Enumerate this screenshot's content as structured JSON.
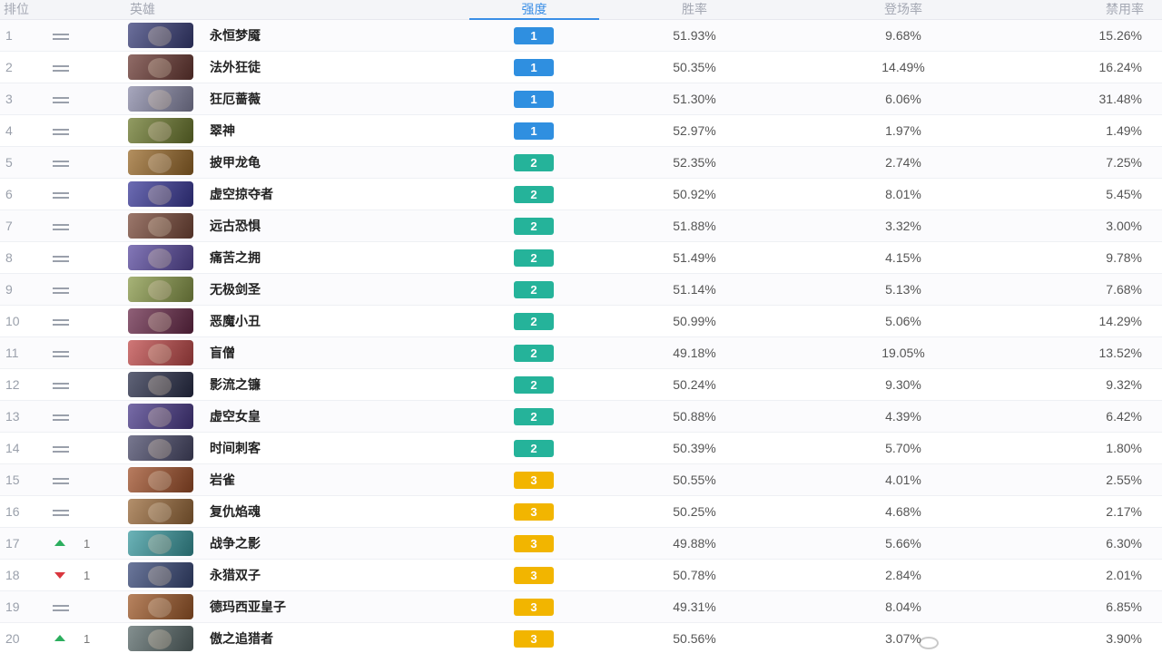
{
  "header": {
    "rank": "排位",
    "hero": "英雄",
    "tier": "强度",
    "win_rate": "胜率",
    "pick_rate": "登场率",
    "ban_rate": "禁用率"
  },
  "tier_colors": {
    "1": "#2f8fe0",
    "2": "#25b39a",
    "3": "#f2b500"
  },
  "trend_colors": {
    "up": "#2cae5e",
    "down": "#d9363e",
    "same": "#9aa0ab"
  },
  "rows": [
    {
      "rank": "1",
      "trend": "same",
      "change": "",
      "name": "永恒梦魇",
      "tier": "1",
      "win": "51.93%",
      "pick": "9.68%",
      "ban": "15.26%",
      "avatar_color": "#3a3f7a"
    },
    {
      "rank": "2",
      "trend": "same",
      "change": "",
      "name": "法外狂徒",
      "tier": "1",
      "win": "50.35%",
      "pick": "14.49%",
      "ban": "16.24%",
      "avatar_color": "#6b3a34"
    },
    {
      "rank": "3",
      "trend": "same",
      "change": "",
      "name": "狂厄蔷薇",
      "tier": "1",
      "win": "51.30%",
      "pick": "6.06%",
      "ban": "31.48%",
      "avatar_color": "#8a8aa8"
    },
    {
      "rank": "4",
      "trend": "same",
      "change": "",
      "name": "翠神",
      "tier": "1",
      "win": "52.97%",
      "pick": "1.97%",
      "ban": "1.49%",
      "avatar_color": "#6d7a2e"
    },
    {
      "rank": "5",
      "trend": "same",
      "change": "",
      "name": "披甲龙龟",
      "tier": "2",
      "win": "52.35%",
      "pick": "2.74%",
      "ban": "7.25%",
      "avatar_color": "#9a6a2a"
    },
    {
      "rank": "6",
      "trend": "same",
      "change": "",
      "name": "虚空掠夺者",
      "tier": "2",
      "win": "50.92%",
      "pick": "8.01%",
      "ban": "5.45%",
      "avatar_color": "#3b3a9a"
    },
    {
      "rank": "7",
      "trend": "same",
      "change": "",
      "name": "远古恐惧",
      "tier": "2",
      "win": "51.88%",
      "pick": "3.32%",
      "ban": "3.00%",
      "avatar_color": "#7a4a3a"
    },
    {
      "rank": "8",
      "trend": "same",
      "change": "",
      "name": "痛苦之拥",
      "tier": "2",
      "win": "51.49%",
      "pick": "4.15%",
      "ban": "9.78%",
      "avatar_color": "#5a4aa0"
    },
    {
      "rank": "9",
      "trend": "same",
      "change": "",
      "name": "无极剑圣",
      "tier": "2",
      "win": "51.14%",
      "pick": "5.13%",
      "ban": "7.68%",
      "avatar_color": "#8a9a4a"
    },
    {
      "rank": "10",
      "trend": "same",
      "change": "",
      "name": "恶魔小丑",
      "tier": "2",
      "win": "50.99%",
      "pick": "5.06%",
      "ban": "14.29%",
      "avatar_color": "#6a2a4a"
    },
    {
      "rank": "11",
      "trend": "same",
      "change": "",
      "name": "盲僧",
      "tier": "2",
      "win": "49.18%",
      "pick": "19.05%",
      "ban": "13.52%",
      "avatar_color": "#c04a4a"
    },
    {
      "rank": "12",
      "trend": "same",
      "change": "",
      "name": "影流之镰",
      "tier": "2",
      "win": "50.24%",
      "pick": "9.30%",
      "ban": "9.32%",
      "avatar_color": "#2a2f4a"
    },
    {
      "rank": "13",
      "trend": "same",
      "change": "",
      "name": "虚空女皇",
      "tier": "2",
      "win": "50.88%",
      "pick": "4.39%",
      "ban": "6.42%",
      "avatar_color": "#4a3a8a"
    },
    {
      "rank": "14",
      "trend": "same",
      "change": "",
      "name": "时间刺客",
      "tier": "2",
      "win": "50.39%",
      "pick": "5.70%",
      "ban": "1.80%",
      "avatar_color": "#4a4a6a"
    },
    {
      "rank": "15",
      "trend": "same",
      "change": "",
      "name": "岩雀",
      "tier": "3",
      "win": "50.55%",
      "pick": "4.01%",
      "ban": "2.55%",
      "avatar_color": "#a0502a"
    },
    {
      "rank": "16",
      "trend": "same",
      "change": "",
      "name": "复仇焰魂",
      "tier": "3",
      "win": "50.25%",
      "pick": "4.68%",
      "ban": "2.17%",
      "avatar_color": "#9a6a3a"
    },
    {
      "rank": "17",
      "trend": "up",
      "change": "1",
      "name": "战争之影",
      "tier": "3",
      "win": "49.88%",
      "pick": "5.66%",
      "ban": "6.30%",
      "avatar_color": "#3a9aa0"
    },
    {
      "rank": "18",
      "trend": "down",
      "change": "1",
      "name": "永猎双子",
      "tier": "3",
      "win": "50.78%",
      "pick": "2.84%",
      "ban": "2.01%",
      "avatar_color": "#3a4a7a"
    },
    {
      "rank": "19",
      "trend": "same",
      "change": "",
      "name": "德玛西亚皇子",
      "tier": "3",
      "win": "49.31%",
      "pick": "8.04%",
      "ban": "6.85%",
      "avatar_color": "#a05a2a"
    },
    {
      "rank": "20",
      "trend": "up",
      "change": "1",
      "name": "傲之追猎者",
      "tier": "3",
      "win": "50.56%",
      "pick": "3.07%",
      "ban": "3.90%",
      "avatar_color": "#5a6a6a"
    }
  ]
}
